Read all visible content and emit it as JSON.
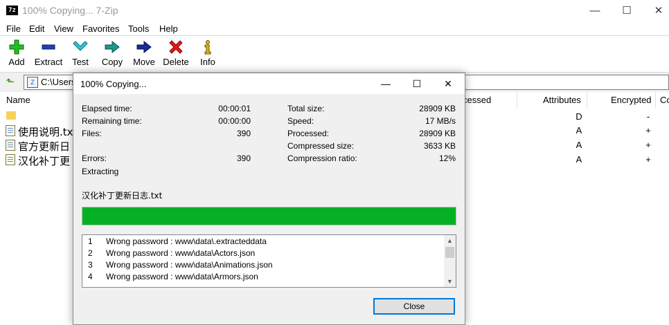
{
  "window": {
    "title": "100% Copying... 7-Zip",
    "icon_text": "7z"
  },
  "menu": [
    "File",
    "Edit",
    "View",
    "Favorites",
    "Tools",
    "Help"
  ],
  "toolbar": [
    {
      "label": "Add",
      "icon": "plus-icon",
      "color": "#1fbf1f"
    },
    {
      "label": "Extract",
      "icon": "minus-icon",
      "color": "#1e3aa8"
    },
    {
      "label": "Test",
      "icon": "check-chevron-icon",
      "color": "#1ab0c8"
    },
    {
      "label": "Copy",
      "icon": "copy-arrow-icon",
      "color": "#1a8a7a"
    },
    {
      "label": "Move",
      "icon": "move-arrow-icon",
      "color": "#1a2a8a"
    },
    {
      "label": "Delete",
      "icon": "delete-x-icon",
      "color": "#e01010"
    },
    {
      "label": "Info",
      "icon": "info-icon",
      "color": "#d8b000"
    }
  ],
  "address": {
    "path": "C:\\Users"
  },
  "columns": {
    "name": "Name",
    "processed": "cessed",
    "attributes": "Attributes",
    "encrypted": "Encrypted",
    "comment": "Co"
  },
  "files": [
    {
      "name": "",
      "attributes": "D",
      "encrypted": "-",
      "type": "folder"
    },
    {
      "name": "使用说明.txt",
      "attributes": "A",
      "encrypted": "+",
      "type": "file"
    },
    {
      "name": "官方更新日",
      "attributes": "A",
      "encrypted": "+",
      "type": "file"
    },
    {
      "name": "汉化补丁更",
      "attributes": "A",
      "encrypted": "+",
      "type": "file"
    }
  ],
  "dialog": {
    "title": "100% Copying...",
    "labels": {
      "elapsed": "Elapsed time:",
      "remaining": "Remaining time:",
      "files": "Files:",
      "errors": "Errors:",
      "total_size": "Total size:",
      "speed": "Speed:",
      "processed": "Processed:",
      "compressed_size": "Compressed size:",
      "compression_ratio": "Compression ratio:"
    },
    "values": {
      "elapsed": "00:00:01",
      "remaining": "00:00:00",
      "files": "390",
      "errors": "390",
      "total_size": "28909 KB",
      "speed": "17 MB/s",
      "processed": "28909 KB",
      "compressed_size": "3633 KB",
      "compression_ratio": "12%"
    },
    "status": "Extracting",
    "current_file": "汉化补丁更新日志.txt",
    "progress": 1.0,
    "log": [
      {
        "num": "1",
        "text": "Wrong password : www\\data\\.extracteddata"
      },
      {
        "num": "2",
        "text": "Wrong password : www\\data\\Actors.json"
      },
      {
        "num": "3",
        "text": "Wrong password : www\\data\\Animations.json"
      },
      {
        "num": "4",
        "text": "Wrong password : www\\data\\Armors.json"
      }
    ],
    "close_label": "Close"
  }
}
